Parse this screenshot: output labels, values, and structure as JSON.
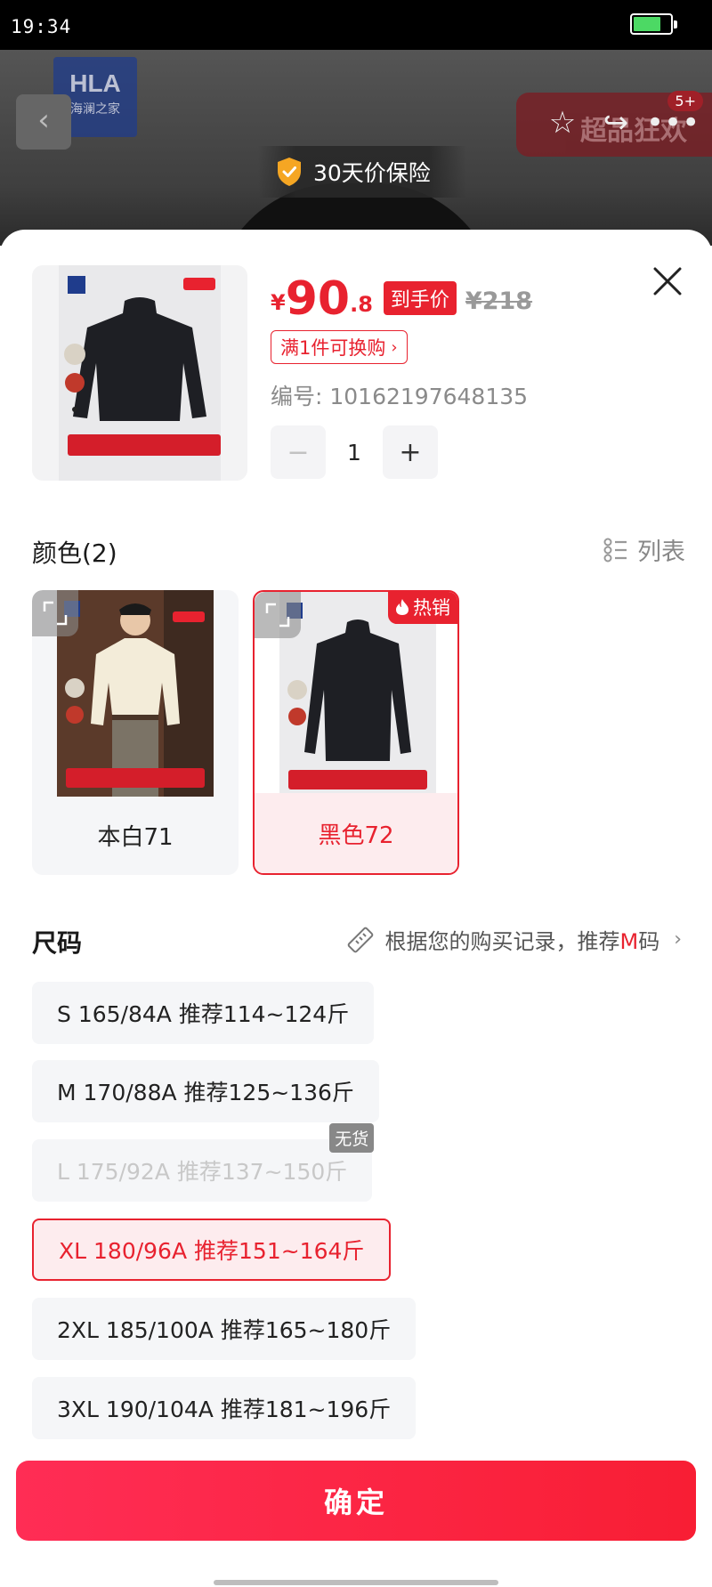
{
  "status_bar": {
    "time": "19:34"
  },
  "background_page": {
    "brand_logo": {
      "line1": "HLA",
      "line2": "海澜之家"
    },
    "promo_text": "超品狂欢",
    "cart_badge": "5+",
    "price_guarantee": "30天价保险"
  },
  "product": {
    "currency": "¥",
    "price_int": "90",
    "price_dec": ".8",
    "final_price_tag": "到手价",
    "original_price": "¥218",
    "exchange_text": "满1件可换购",
    "sku_text": "编号: 10162197648135",
    "quantity": "1"
  },
  "color_section": {
    "title": "颜色(2)",
    "view_toggle": "列表",
    "options": [
      {
        "label": "本白71",
        "selected": false,
        "hot": false
      },
      {
        "label": "黑色72",
        "selected": true,
        "hot": true,
        "hot_label": "热销"
      }
    ]
  },
  "size_section": {
    "title": "尺码",
    "recommendation": {
      "prefix": "根据您的购买记录，推荐",
      "size": "M",
      "suffix": "码"
    },
    "options": [
      {
        "label": "S 165/84A 推荐114~124斤",
        "state": "normal"
      },
      {
        "label": "M 170/88A 推荐125~136斤",
        "state": "normal"
      },
      {
        "label": "L 175/92A 推荐137~150斤",
        "state": "disabled",
        "badge": "无货"
      },
      {
        "label": "XL 180/96A 推荐151~164斤",
        "state": "selected"
      },
      {
        "label": "2XL 185/100A 推荐165~180斤",
        "state": "normal"
      },
      {
        "label": "3XL 190/104A 推荐181~196斤",
        "state": "normal"
      }
    ]
  },
  "confirm_button": "确定",
  "colors": {
    "accent": "#e8222f",
    "accent_light": "#fdecee",
    "confirm_gradient_start": "#ff2d55"
  }
}
